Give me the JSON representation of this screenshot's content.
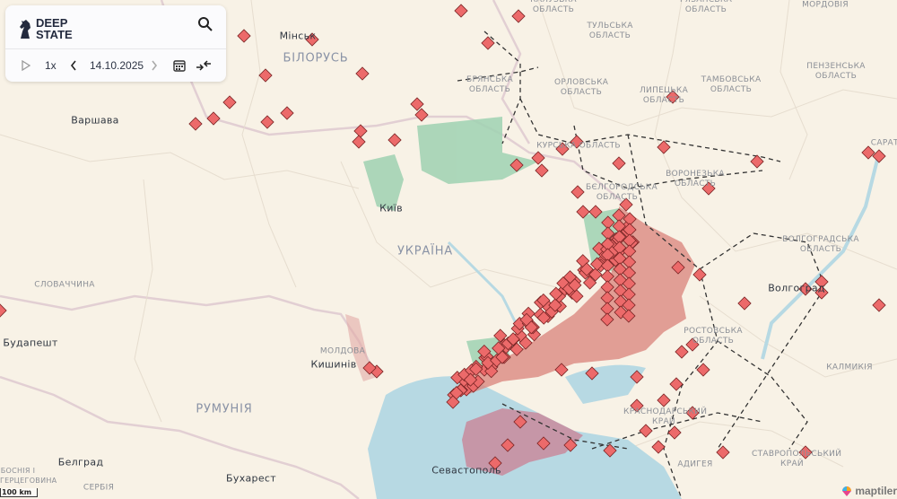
{
  "app": {
    "logo_line1": "DEEP",
    "logo_line2": "STATE"
  },
  "controls": {
    "speed": "1x",
    "date": "14.10.2025"
  },
  "labels": {
    "countries": {
      "belarus": "БІЛОРУСЬ",
      "ukraine": "УКРАЇНА",
      "romania": "РУМУНІЯ",
      "moldova": "МОЛДОВА",
      "slovakia": "СЛОВАЧЧИНА",
      "serbia": "СЕРБІЯ",
      "bosnia": "БОСНІЯ І ГЕРЦЕГОВИНА",
      "kalmykia": "КАЛМИКІЯ",
      "mordovia": "МОРДОВІЯ"
    },
    "regions": {
      "kaluga": "КАЛУЗЬКА ОБЛАСТЬ",
      "ryazan": "РЯЗАНСЬКА ОБЛАСТЬ",
      "tula": "ТУЛЬСЬКА ОБЛАСТЬ",
      "bryansk": "БРЯНСЬКА ОБЛАСТЬ",
      "oryol": "ОРЛОВСЬКА ОБЛАСТЬ",
      "lipetsk": "ЛИПЕЦЬКА ОБЛАСТЬ",
      "tambov": "ТАМБОВСЬКА ОБЛАСТЬ",
      "penza": "ПЕНЗЕНСЬКА ОБЛАСТЬ",
      "kursk": "КУРСЬКА ОБЛАСТЬ",
      "belgorod": "БЄЛГОРОДСЬКА ОБЛАСТЬ",
      "voronezh": "ВОРОНЕЗЬКА ОБЛАСТЬ",
      "volgograd": "ВОЛГОГРАДСЬКА ОБЛАСТЬ",
      "rostov": "РОСТОВСЬКА ОБЛАСТЬ",
      "krasnodar": "КРАСНОДАРСЬКИЙ КРАЙ",
      "stavropol": "СТАВРОПОЛЬСЬКИЙ КРАЙ",
      "adygea": "АДИГЕЯ",
      "saratov": "САРАТО"
    },
    "cities": {
      "minsk": "Мінськ",
      "warsaw": "Варшава",
      "kyiv": "Київ",
      "budapest": "Будапешт",
      "chisinau": "Кишинів",
      "belgrade": "Белград",
      "bucharest": "Бухарест",
      "sevastopol": "Севастополь",
      "volgograd": "Волгоград"
    }
  },
  "scale": "100 km",
  "attribution": "maptiler",
  "colors": {
    "occupied": "#d9817a",
    "crimea": "#c98a9c",
    "liberated": "#9fd2b2",
    "sea": "#b7d9e3",
    "marker": "#ec6a6a"
  }
}
